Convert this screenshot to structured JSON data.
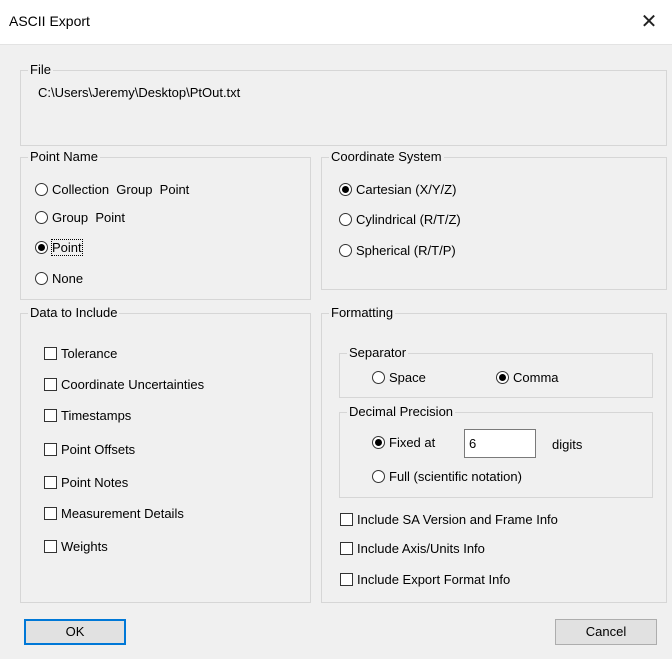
{
  "window": {
    "title": "ASCII Export",
    "close_glyph": "✕"
  },
  "file": {
    "label": "File",
    "path": "C:\\Users\\Jeremy\\Desktop\\PtOut.txt"
  },
  "point_name": {
    "label": "Point Name",
    "options": [
      "Collection  Group  Point",
      "Group  Point",
      "Point",
      "None"
    ],
    "selected": "Point"
  },
  "coordinate_system": {
    "label": "Coordinate System",
    "options": [
      "Cartesian (X/Y/Z)",
      "Cylindrical (R/T/Z)",
      "Spherical (R/T/P)"
    ],
    "selected": "Cartesian (X/Y/Z)"
  },
  "data_to_include": {
    "label": "Data to Include",
    "items": [
      "Tolerance",
      "Coordinate Uncertainties",
      "Timestamps",
      "Point Offsets",
      "Point Notes",
      "Measurement Details",
      "Weights"
    ]
  },
  "formatting": {
    "label": "Formatting",
    "separator": {
      "label": "Separator",
      "options": [
        "Space",
        "Comma"
      ],
      "selected": "Comma"
    },
    "decimal_precision": {
      "label": "Decimal Precision",
      "fixed_label": "Fixed at",
      "fixed_value": "6",
      "digits_label": "digits",
      "full_label": "Full (scientific notation)",
      "selected": "Fixed at"
    },
    "checkboxes": [
      "Include SA Version and Frame Info",
      "Include Axis/Units Info",
      "Include Export Format Info"
    ]
  },
  "buttons": {
    "ok": "OK",
    "cancel": "Cancel"
  }
}
